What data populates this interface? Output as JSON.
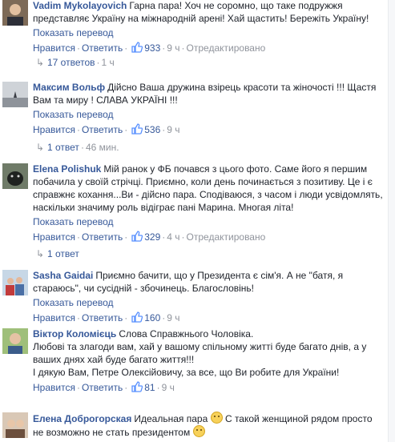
{
  "labels": {
    "translate": "Показать перевод",
    "like": "Нравится",
    "reply": "Ответить",
    "edited": "Отредактировано"
  },
  "comments": [
    {
      "author": "Vadim Mykolayovich",
      "text": "Гарна пара! Хоч не соромно, що таке подружжя представляє Україну на міжнародній арені! Хай щастить! Бережіть Україну!",
      "likes": "933",
      "time": "9 ч",
      "edited": true,
      "replies": "17 ответов",
      "replies_time": "1 ч"
    },
    {
      "author": "Максим Вольф",
      "text": "Дійсно Ваша дружина взірець красоти та жіночості !!! Щастя Вам та миру ! СЛАВА УКРАЇНІ !!!",
      "likes": "536",
      "time": "9 ч",
      "edited": false,
      "replies": "1 ответ",
      "replies_time": "46 мин."
    },
    {
      "author": "Elena Polishuk",
      "text": "Мій ранок у ФБ почався з цього фото. Саме його я першим побачила у своїй стрічці. Приємно, коли день починається з позитиву. Це і є справжнє кохання...Ви - дійсно пара. Сподіваюся, з часом і люди усвідомлять, наскільки значиму роль відіграє пані Марина. Многая літа!",
      "likes": "329",
      "time": "4 ч",
      "edited": true,
      "replies": "1 ответ",
      "replies_time": ""
    },
    {
      "author": "Sasha Gaidai",
      "text": "Приємно бачити, що у Президента є сім'я. А не \"батя, я стараюсь\", чи сусідній - збочинець. Благословінь!",
      "likes": "160",
      "time": "9 ч",
      "edited": false
    },
    {
      "author": "Віктор Коломієць",
      "text_lines": [
        "Слова Справжнього Чоловіка.",
        "Любові та злагоди вам, хай у вашому спільному житті буде багато днів, а у ваших днях хай буде багато життя!!!",
        "І дякую Вам, Петре Олексійовичу, за все, що Ви робите для України!"
      ],
      "likes": "81",
      "time": "9 ч",
      "edited": false
    },
    {
      "author": "Елена Доброгорская",
      "text_a": "Идеальная пара",
      "text_b": "С такой женщиной рядом просто не возможно не стать президентом"
    }
  ],
  "colors": {
    "link": "#365899",
    "meta": "#90949c",
    "text": "#1d2129",
    "like_badge": "#5890ff"
  }
}
